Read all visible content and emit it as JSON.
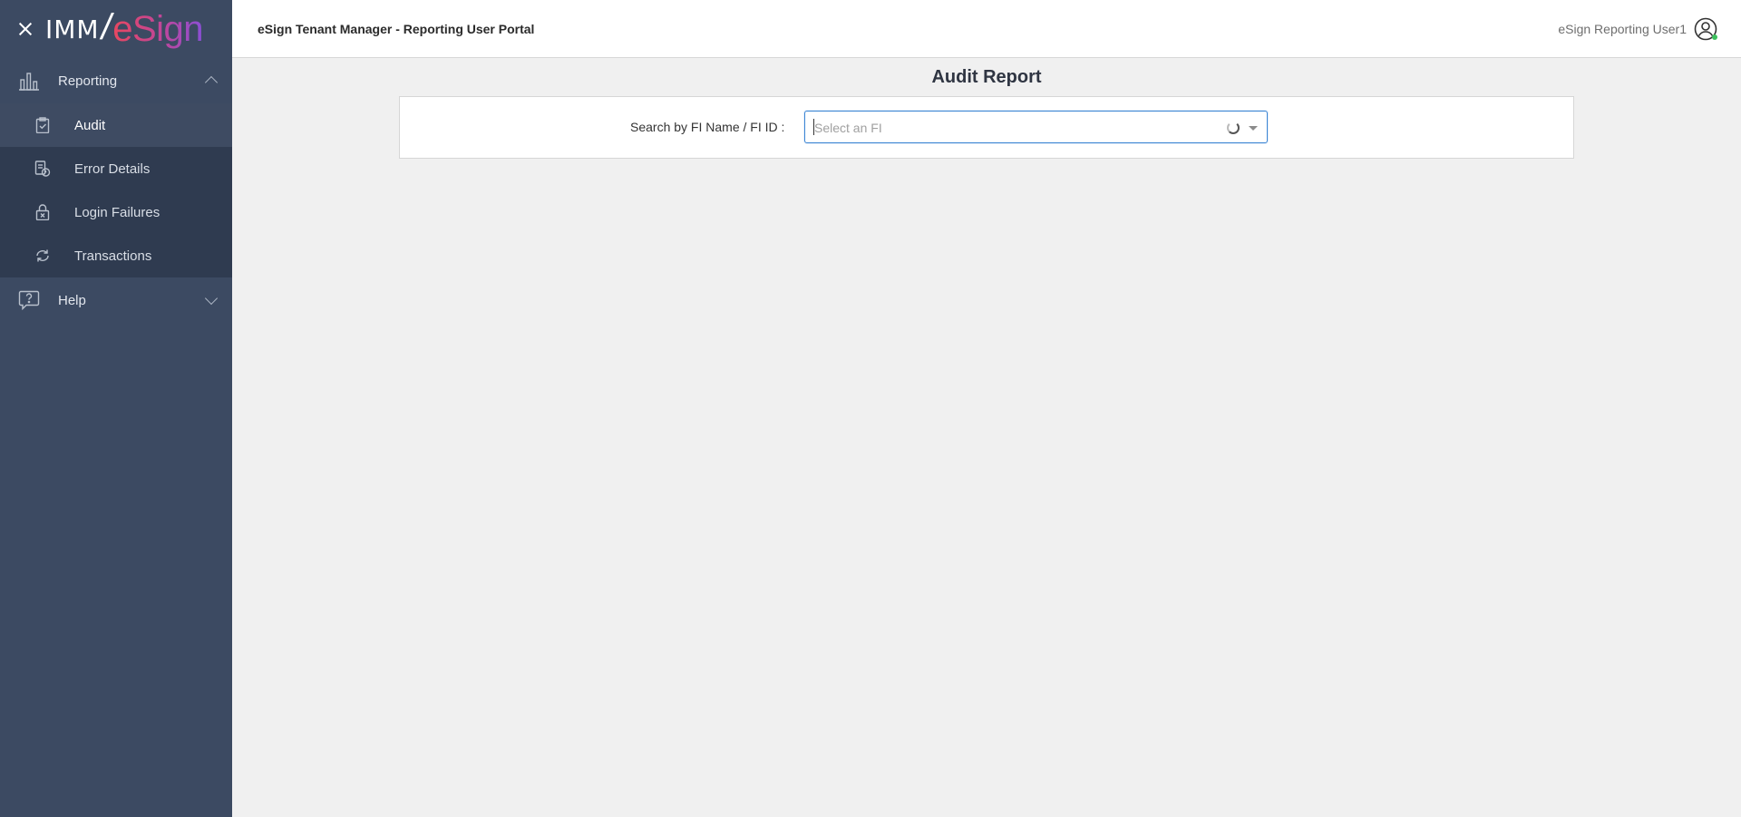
{
  "brand": {
    "imm": "IMM",
    "slash": "/",
    "esign": "eSign"
  },
  "header": {
    "title": "eSign Tenant Manager - Reporting User Portal",
    "user_name": "eSign Reporting User1"
  },
  "sidebar": {
    "reporting_label": "Reporting",
    "items": [
      {
        "label": "Audit",
        "icon": "clipboard-check-icon",
        "active": true
      },
      {
        "label": "Error Details",
        "icon": "document-error-icon"
      },
      {
        "label": "Login Failures",
        "icon": "lock-x-icon"
      },
      {
        "label": "Transactions",
        "icon": "cycle-icon"
      }
    ],
    "help_label": "Help"
  },
  "main": {
    "page_title": "Audit Report",
    "search_label": "Search by FI Name / FI ID :",
    "select_placeholder": "Select an FI"
  },
  "colors": {
    "sidebar_bg": "#3c4a62",
    "submenu_bg": "#2f3b50",
    "focus_border": "#3d86d4",
    "online_status": "#3cbf5c"
  }
}
